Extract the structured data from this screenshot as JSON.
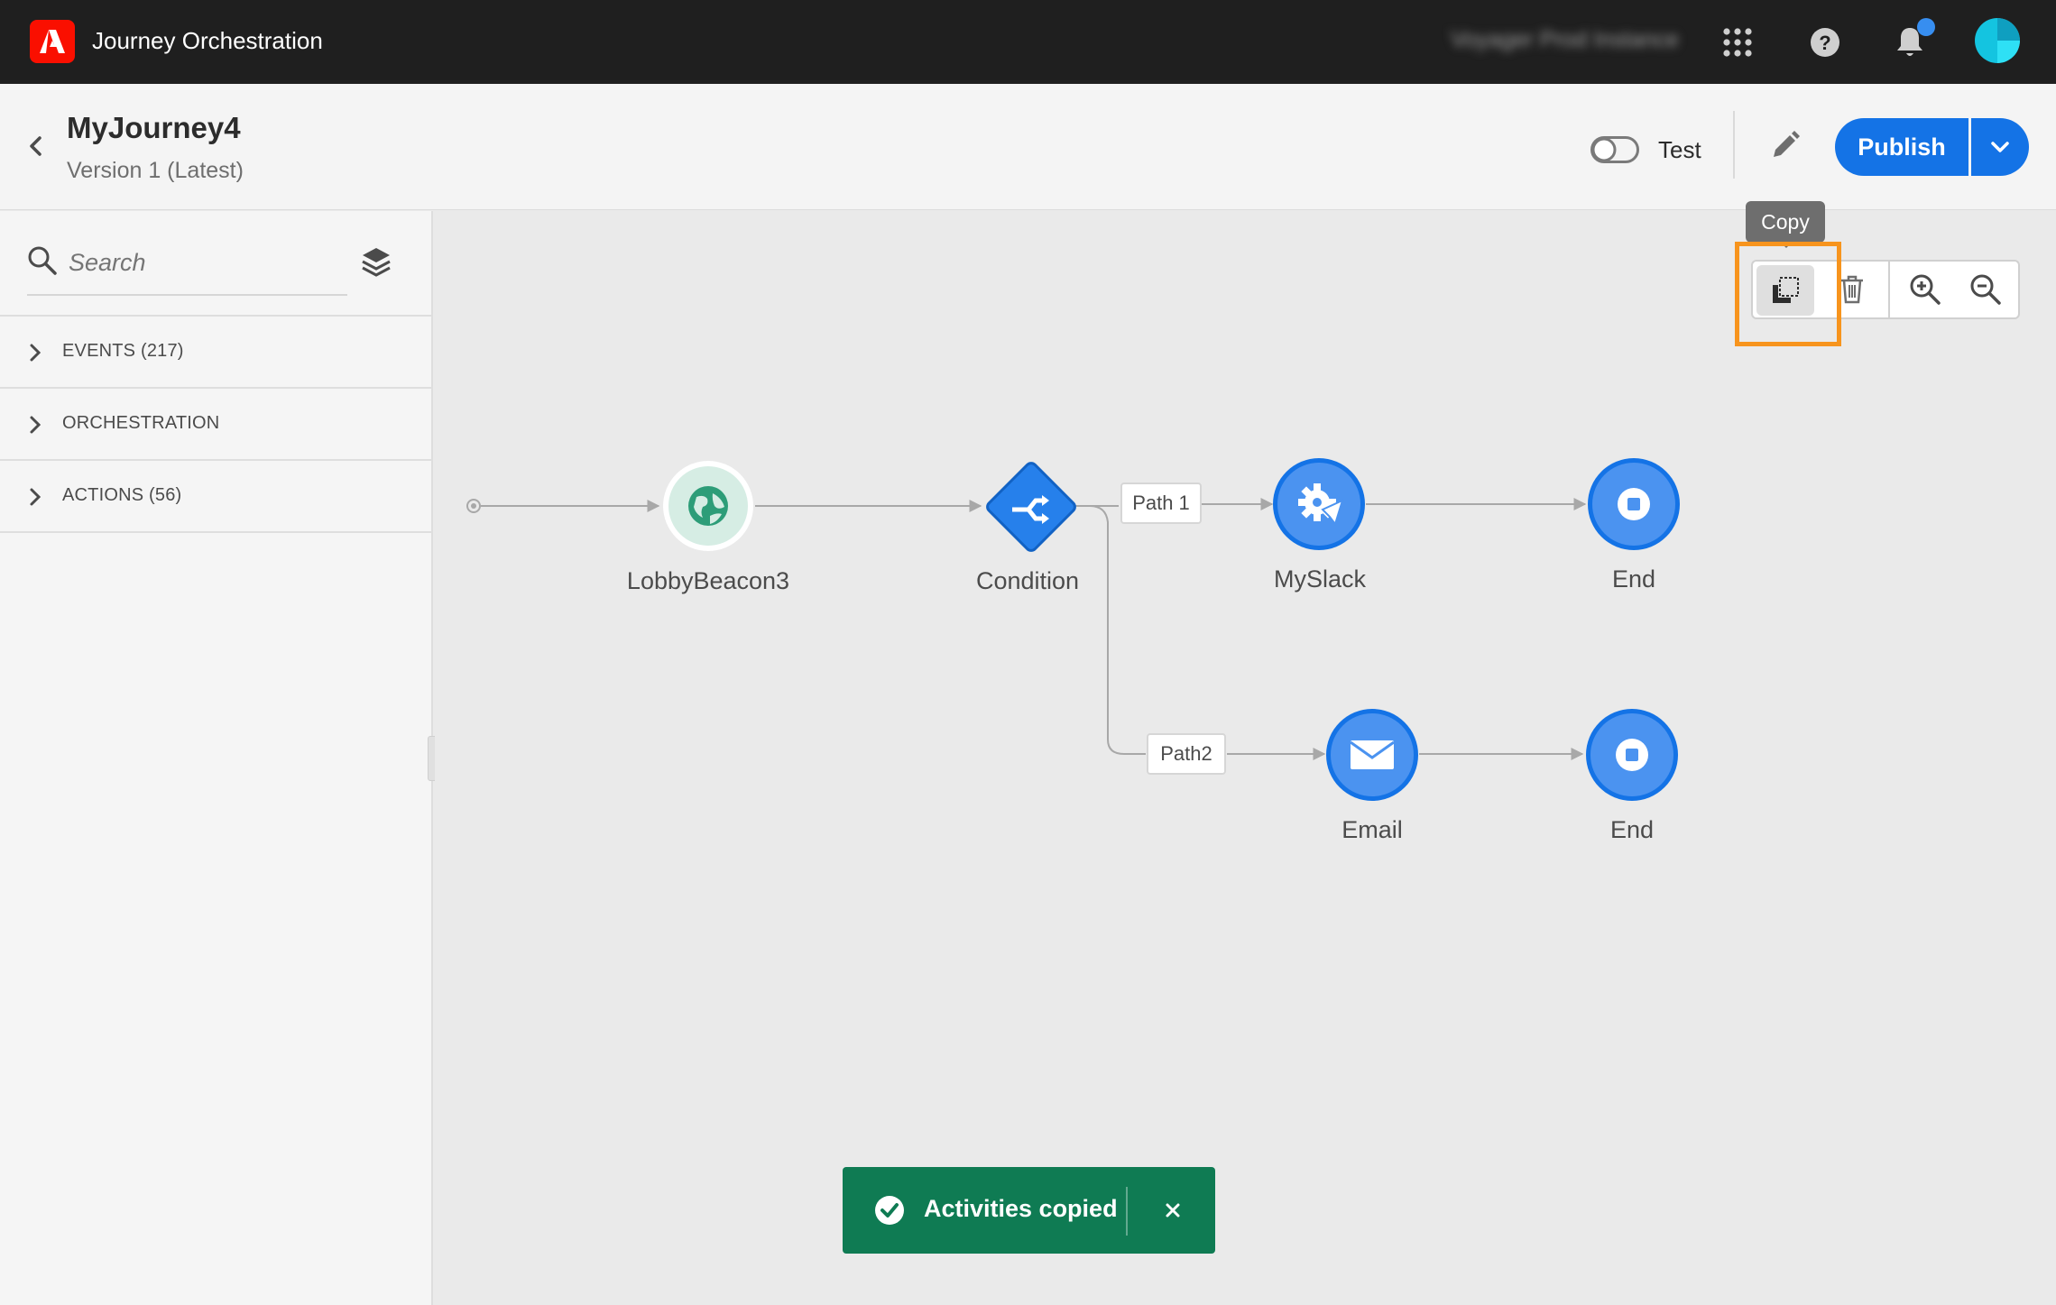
{
  "topbar": {
    "app_title": "Journey Orchestration",
    "instance_name": "Voyager Prod Instance",
    "icons": [
      "adobe-logo-icon",
      "apps-grid-icon",
      "help-icon",
      "bell-icon",
      "avatar"
    ],
    "notification_dot_color": "#378ef0",
    "bar_color": "#1f1f1f",
    "logo_color": "#fa0f00"
  },
  "header": {
    "journey_name": "MyJourney4",
    "version": "Version 1 (Latest)",
    "test_label": "Test",
    "test_toggle_on": false,
    "publish_label": "Publish",
    "accent_color": "#1473e6"
  },
  "sidebar": {
    "search_placeholder": "Search",
    "sections": [
      {
        "label": "EVENTS (217)"
      },
      {
        "label": "ORCHESTRATION"
      },
      {
        "label": "ACTIONS (56)"
      }
    ]
  },
  "canvas": {
    "toolbar": {
      "tooltip": "Copy",
      "buttons": [
        "copy-icon",
        "trash-icon",
        "zoom-in-icon",
        "zoom-out-icon"
      ],
      "highlight_color": "#f7941d"
    },
    "nodes": {
      "event": "LobbyBeacon3",
      "condition": "Condition",
      "action1": "MySlack",
      "end1": "End",
      "action2": "Email",
      "end2": "End"
    },
    "paths": {
      "path1": "Path 1",
      "path2": "Path2"
    },
    "node_color": "#2680eb",
    "event_color": "#2d9d78"
  },
  "toast": {
    "message": "Activities copied",
    "color": "#0f7b53"
  }
}
